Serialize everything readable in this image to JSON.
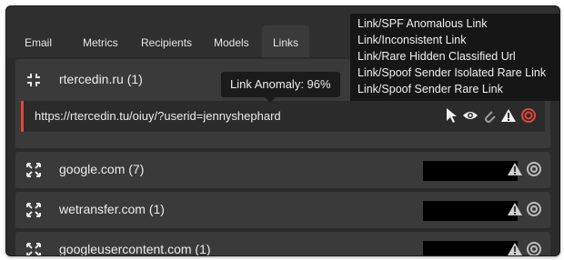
{
  "tabs": [
    "Email",
    "Metrics",
    "Recipients",
    "Models",
    "Links"
  ],
  "expanded_link": {
    "domain": "rtercedin.ru (1)",
    "url": "https://rtercedin.tu/oiuy/?userid=jennyshephard"
  },
  "tooltip": "Link Anomaly: 96%",
  "popup_items": [
    "Link/SPF Anomalous Link",
    "Link/Inconsistent Link",
    "Link/Rare Hidden Classified Url",
    "Link/Spoof Sender Isolated Rare Link",
    "Link/Spoof Sender Rare Link"
  ],
  "links": [
    {
      "domain": "google.com (7)"
    },
    {
      "domain": "wetransfer.com (1)"
    },
    {
      "domain": "googleusercontent.com (1)"
    }
  ],
  "colors": {
    "alert": "#e0473c",
    "background": "#2b2b2b",
    "row": "#3a3a3a"
  },
  "icons": [
    "collapse-icon",
    "expand-icon",
    "cursor-icon",
    "eye-icon",
    "paperclip-icon",
    "warning-icon",
    "alert-ring-icon",
    "circle-icon"
  ]
}
